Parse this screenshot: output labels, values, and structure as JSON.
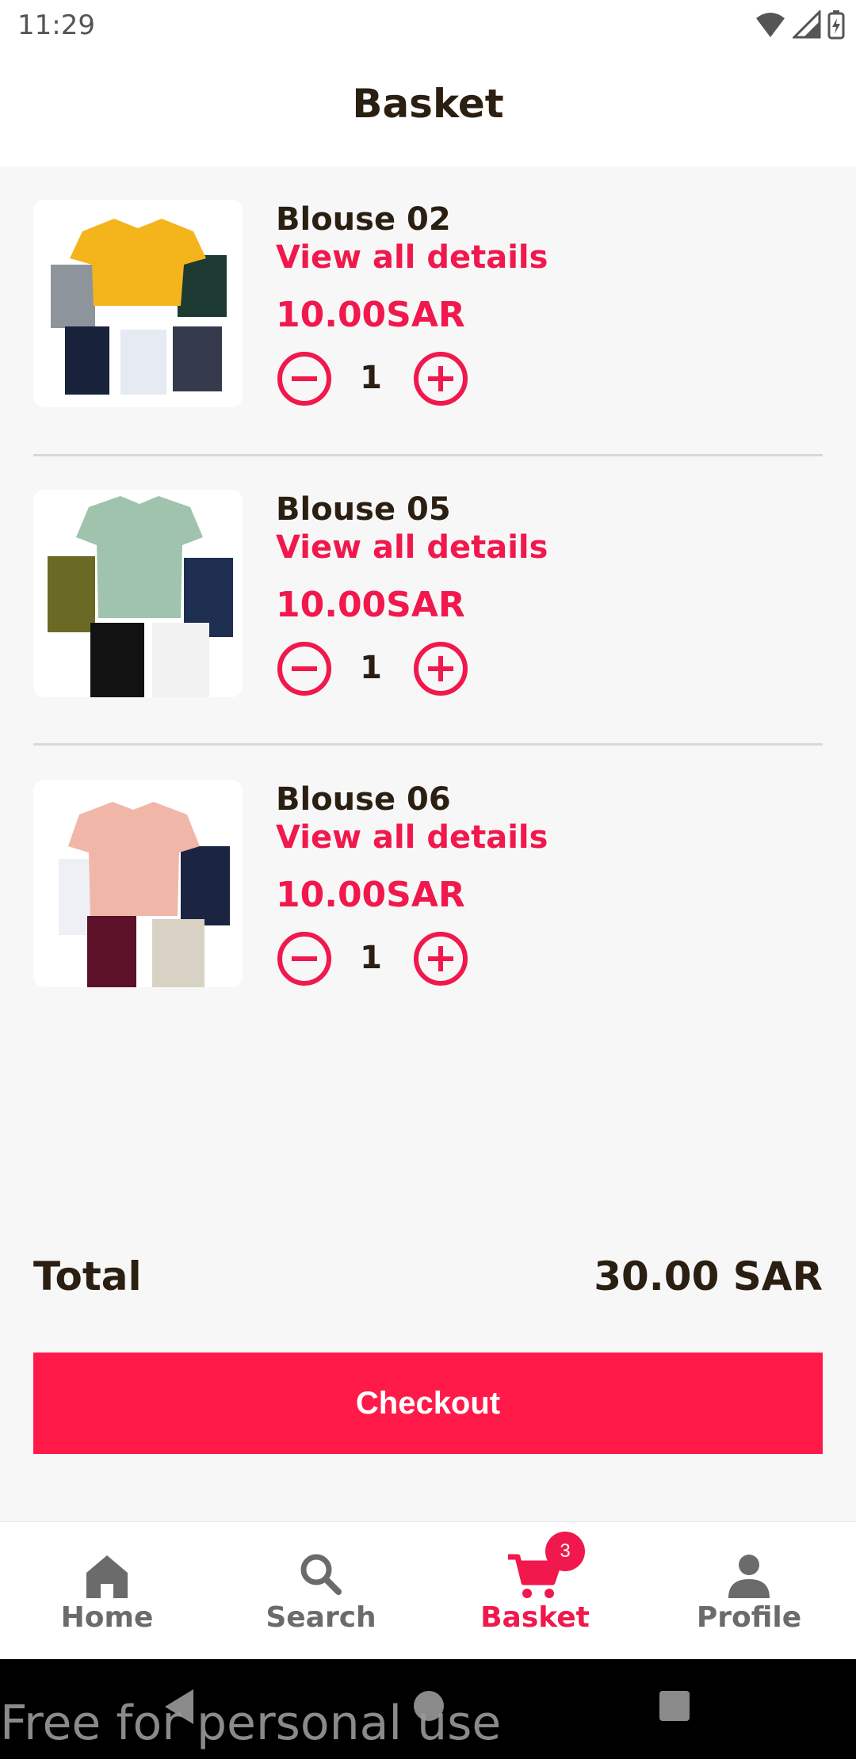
{
  "status_bar": {
    "time": "11:29"
  },
  "header": {
    "title": "Basket"
  },
  "items": [
    {
      "name": "Blouse 02",
      "link": "View all details",
      "price": "10.00SAR",
      "quantity": "1"
    },
    {
      "name": "Blouse 05",
      "link": "View all details",
      "price": "10.00SAR",
      "quantity": "1"
    },
    {
      "name": "Blouse 06",
      "link": "View all details",
      "price": "10.00SAR",
      "quantity": "1"
    }
  ],
  "summary": {
    "total_label": "Total",
    "total_value": "30.00 SAR"
  },
  "checkout_label": "Checkout",
  "nav": {
    "items": [
      {
        "label": "Home",
        "icon": "home-icon"
      },
      {
        "label": "Search",
        "icon": "search-icon"
      },
      {
        "label": "Basket",
        "icon": "cart-icon",
        "badge": "3"
      },
      {
        "label": "Profile",
        "icon": "person-icon"
      }
    ],
    "active": "Basket"
  },
  "colors": {
    "accent": "#f0184c",
    "checkout": "#ff1a4a",
    "text": "#2b1f12",
    "nav_inactive": "#6b6b6b"
  },
  "watermark": "Free for personal use"
}
